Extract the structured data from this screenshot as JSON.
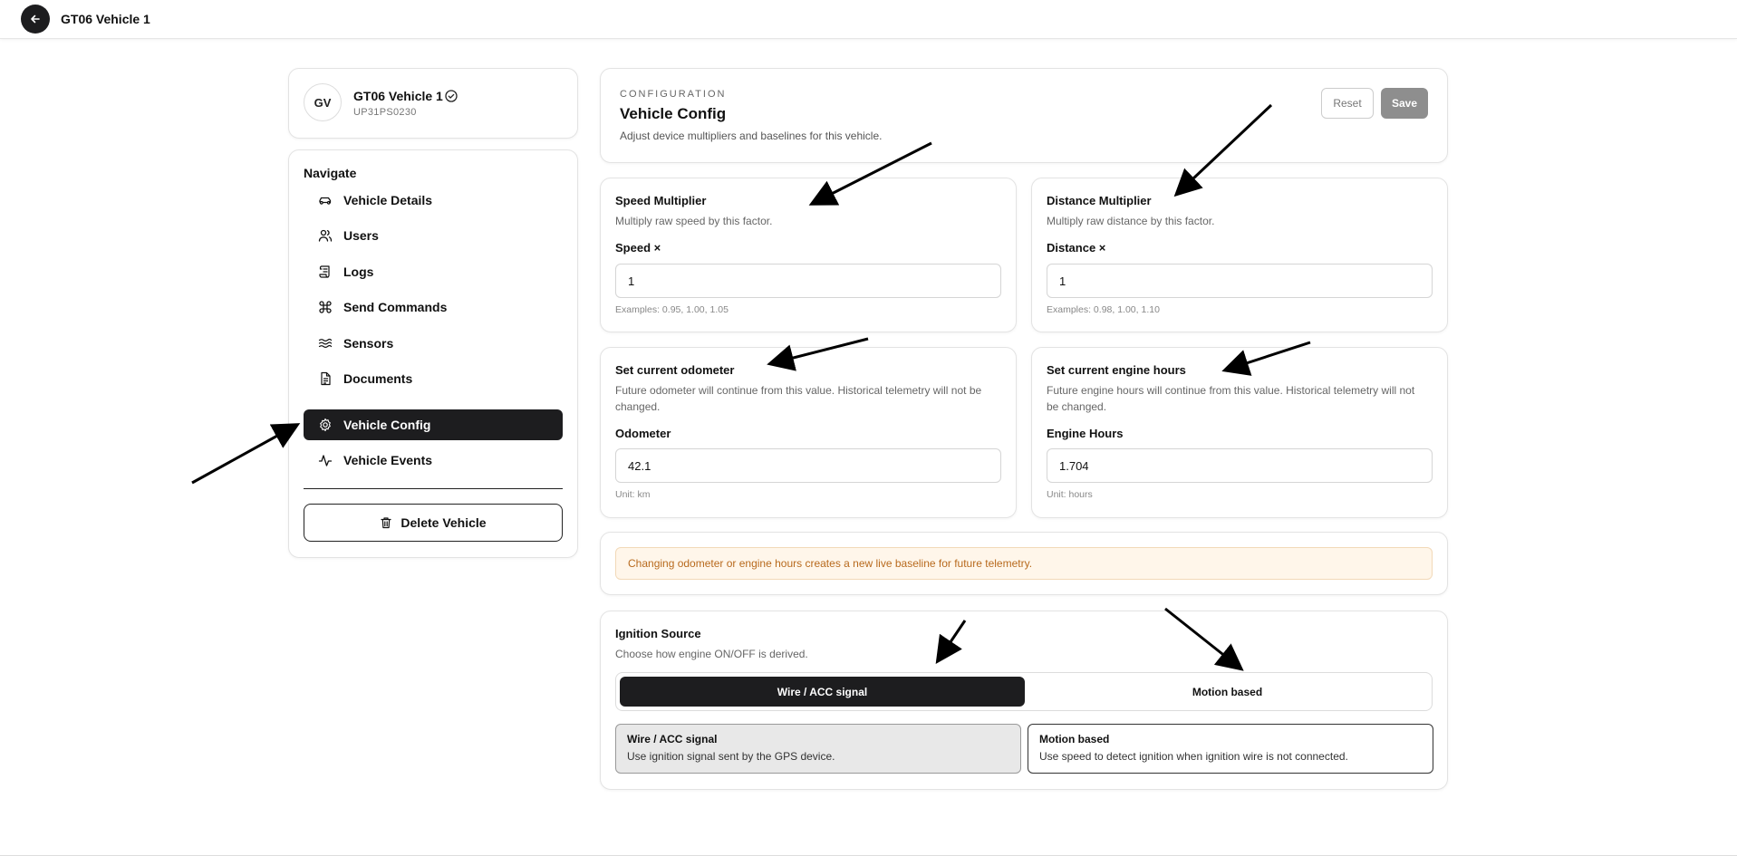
{
  "header": {
    "title": "GT06 Vehicle 1"
  },
  "vehicle": {
    "initials": "GV",
    "name": "GT06 Vehicle 1",
    "plate": "UP31PS0230"
  },
  "nav": {
    "heading": "Navigate",
    "items": [
      {
        "label": "Vehicle Details",
        "icon": "car-icon"
      },
      {
        "label": "Users",
        "icon": "users-icon"
      },
      {
        "label": "Logs",
        "icon": "scroll-icon"
      },
      {
        "label": "Send Commands",
        "icon": "command-icon"
      },
      {
        "label": "Sensors",
        "icon": "waves-icon"
      },
      {
        "label": "Documents",
        "icon": "document-icon"
      },
      {
        "label": "Vehicle Config",
        "icon": "gear-icon",
        "active": true
      },
      {
        "label": "Vehicle Events",
        "icon": "activity-icon"
      }
    ],
    "delete_label": "Delete Vehicle"
  },
  "config": {
    "eyebrow": "CONFIGURATION",
    "title": "Vehicle Config",
    "subtitle": "Adjust device multipliers and baselines for this vehicle.",
    "reset_label": "Reset",
    "save_label": "Save"
  },
  "speed": {
    "title": "Speed Multiplier",
    "desc": "Multiply raw speed by this factor.",
    "label": "Speed ×",
    "value": "1",
    "hint": "Examples: 0.95, 1.00, 1.05"
  },
  "distance": {
    "title": "Distance Multiplier",
    "desc": "Multiply raw distance by this factor.",
    "label": "Distance ×",
    "value": "1",
    "hint": "Examples: 0.98, 1.00, 1.10"
  },
  "odometer": {
    "title": "Set current odometer",
    "desc": "Future odometer will continue from this value. Historical telemetry will not be changed.",
    "label": "Odometer",
    "value": "42.1",
    "hint": "Unit: km"
  },
  "engine": {
    "title": "Set current engine hours",
    "desc": "Future engine hours will continue from this value. Historical telemetry will not be changed.",
    "label": "Engine Hours",
    "value": "1.704",
    "hint": "Unit: hours"
  },
  "warning": "Changing odometer or engine hours creates a new live baseline for future telemetry.",
  "ignition": {
    "title": "Ignition Source",
    "desc": "Choose how engine ON/OFF is derived.",
    "options": [
      {
        "label": "Wire / ACC signal",
        "desc": "Use ignition signal sent by the GPS device.",
        "selected": true
      },
      {
        "label": "Motion based",
        "desc": "Use speed to detect ignition when ignition wire is not connected.",
        "selected": false
      }
    ]
  },
  "colors": {
    "accent": "#1d1d1f",
    "warning_bg": "#fff6ea",
    "warning_text": "#b86a1e",
    "save_disabled": "#8e8e8e"
  }
}
